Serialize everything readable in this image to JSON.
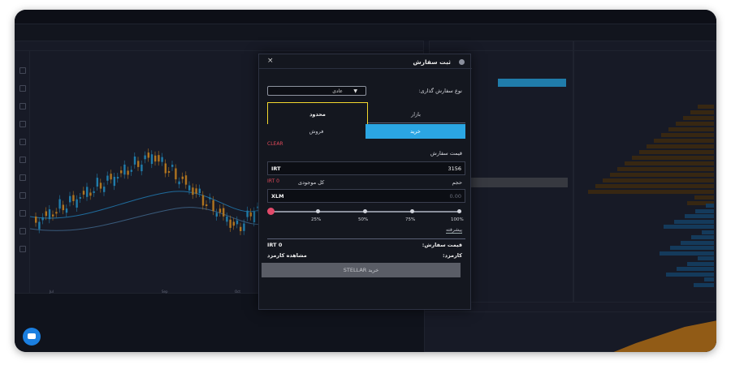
{
  "topbar": {
    "logo": "",
    "items": [
      "",
      "",
      "",
      "",
      ""
    ]
  },
  "chart": {
    "x_ticks": [
      "Jul",
      "",
      "",
      "Sep",
      "",
      "Oct"
    ]
  },
  "order_form": {
    "title": "ثبت سفارش",
    "close_icon": "close-icon",
    "order_type_label": "نوع سفارش گذاری:",
    "order_type_value": "عادی",
    "tabs": {
      "market": "بازار",
      "limit": "محدود"
    },
    "side_tabs": {
      "buy": "خرید",
      "sell": "فروش"
    },
    "clear_label": "CLEAR",
    "price_label": "قیمت سفارش",
    "price_value": "3156",
    "price_unit": "IRT",
    "volume_label": "حجم",
    "total_balance_label": "کل موجودی",
    "total_balance_value": "IRT 0",
    "volume_placeholder": "0.00",
    "volume_unit": "XLM",
    "slider_percent": 0,
    "slider_marks": [
      "25%",
      "50%",
      "75%",
      "100%"
    ],
    "advanced_link": "پیشرفته",
    "order_price_label": "قیمت سفارش:",
    "order_price_value": "IRT 0",
    "fee_label": "کارمزد:",
    "fee_value": "مشاهده کارمزد",
    "submit_label": "خرید STELLAR"
  },
  "colors": {
    "accent_buy": "#2ba6e3",
    "highlight": "#f2d72e",
    "danger": "#e24a5a",
    "bid": "#1b6fb8",
    "ask": "#c27a1e"
  }
}
